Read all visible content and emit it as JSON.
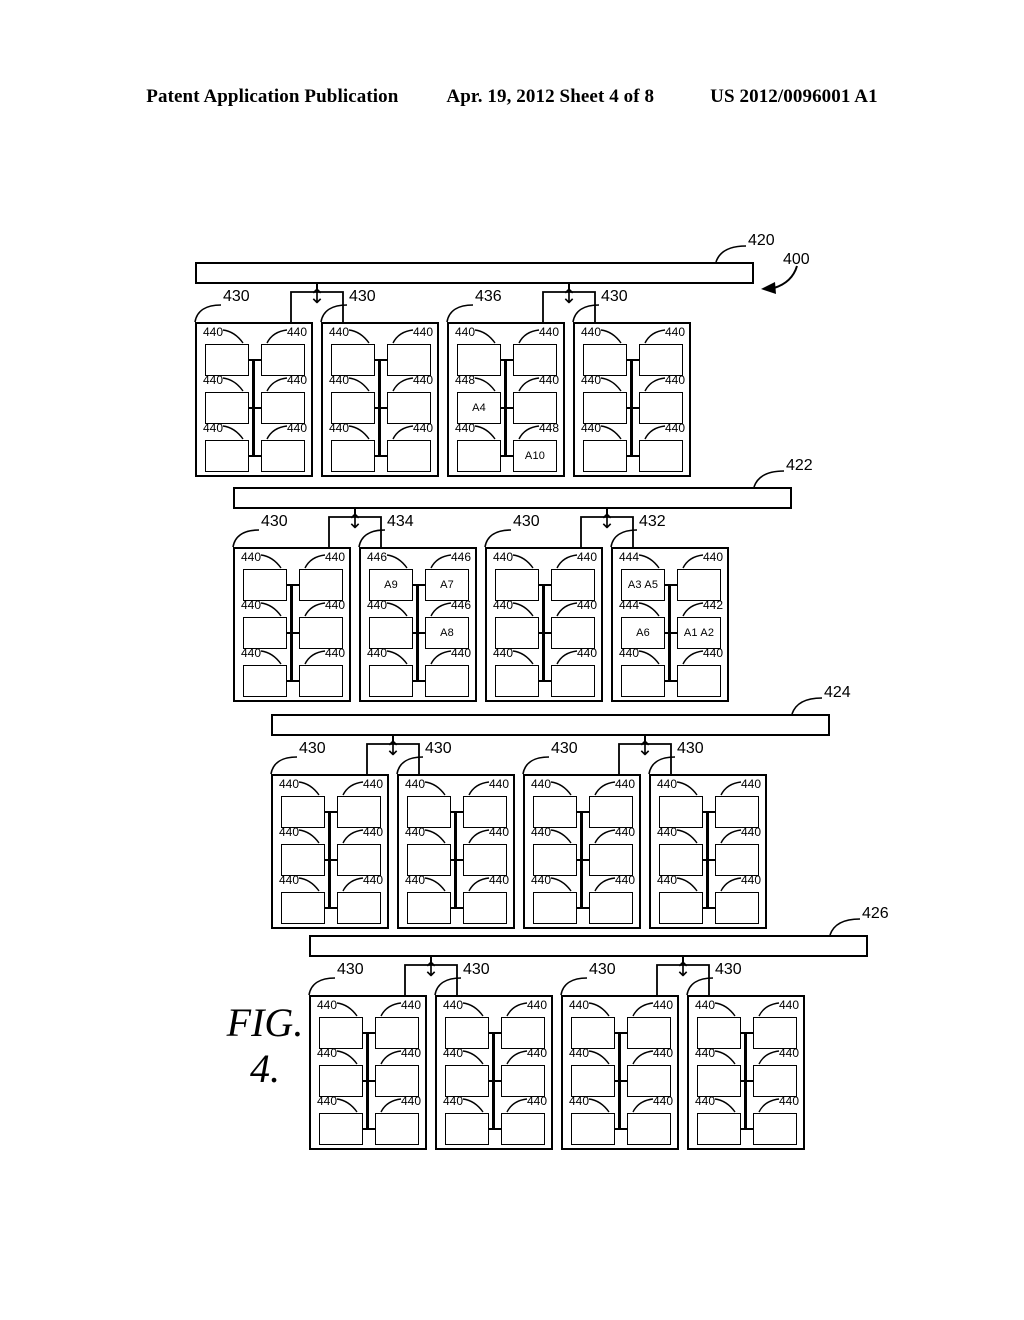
{
  "header": {
    "publication": "Patent Application Publication",
    "date_sheet": "Apr. 19, 2012  Sheet 4 of 8",
    "patent_number": "US 2012/0096001 A1"
  },
  "figure": {
    "caption_line1": "FIG.",
    "caption_line2": "4.",
    "system_ref": "400",
    "cell_default_ref": "440",
    "group_default_ref": "430",
    "arrow_glyph": "↕"
  },
  "banks": [
    {
      "bus_ref": "420",
      "groups": [
        {
          "ref": "430",
          "cells": [
            {
              "ref": "440",
              "text": ""
            },
            {
              "ref": "440",
              "text": ""
            },
            {
              "ref": "440",
              "text": ""
            },
            {
              "ref": "440",
              "text": ""
            },
            {
              "ref": "440",
              "text": ""
            },
            {
              "ref": "440",
              "text": ""
            }
          ]
        },
        {
          "ref": "430",
          "cells": [
            {
              "ref": "440",
              "text": ""
            },
            {
              "ref": "440",
              "text": ""
            },
            {
              "ref": "440",
              "text": ""
            },
            {
              "ref": "440",
              "text": ""
            },
            {
              "ref": "440",
              "text": ""
            },
            {
              "ref": "440",
              "text": ""
            }
          ]
        },
        {
          "ref": "436",
          "cells": [
            {
              "ref": "440",
              "text": ""
            },
            {
              "ref": "440",
              "text": ""
            },
            {
              "ref": "448",
              "text": "A4"
            },
            {
              "ref": "440",
              "text": ""
            },
            {
              "ref": "440",
              "text": ""
            },
            {
              "ref": "448",
              "text": "A10"
            }
          ]
        },
        {
          "ref": "430",
          "cells": [
            {
              "ref": "440",
              "text": ""
            },
            {
              "ref": "440",
              "text": ""
            },
            {
              "ref": "440",
              "text": ""
            },
            {
              "ref": "440",
              "text": ""
            },
            {
              "ref": "440",
              "text": ""
            },
            {
              "ref": "440",
              "text": ""
            }
          ]
        }
      ]
    },
    {
      "bus_ref": "422",
      "groups": [
        {
          "ref": "430",
          "cells": [
            {
              "ref": "440",
              "text": ""
            },
            {
              "ref": "440",
              "text": ""
            },
            {
              "ref": "440",
              "text": ""
            },
            {
              "ref": "440",
              "text": ""
            },
            {
              "ref": "440",
              "text": ""
            },
            {
              "ref": "440",
              "text": ""
            }
          ]
        },
        {
          "ref": "434",
          "cells": [
            {
              "ref": "446",
              "text": "A9"
            },
            {
              "ref": "446",
              "text": "A7"
            },
            {
              "ref": "440",
              "text": ""
            },
            {
              "ref": "446",
              "text": "A8"
            },
            {
              "ref": "440",
              "text": ""
            },
            {
              "ref": "440",
              "text": ""
            }
          ]
        },
        {
          "ref": "430",
          "cells": [
            {
              "ref": "440",
              "text": ""
            },
            {
              "ref": "440",
              "text": ""
            },
            {
              "ref": "440",
              "text": ""
            },
            {
              "ref": "440",
              "text": ""
            },
            {
              "ref": "440",
              "text": ""
            },
            {
              "ref": "440",
              "text": ""
            }
          ]
        },
        {
          "ref": "432",
          "cells": [
            {
              "ref": "444",
              "text": "A3 A5"
            },
            {
              "ref": "440",
              "text": ""
            },
            {
              "ref": "444",
              "text": "A6"
            },
            {
              "ref": "442",
              "text": "A1 A2"
            },
            {
              "ref": "440",
              "text": ""
            },
            {
              "ref": "440",
              "text": ""
            }
          ]
        }
      ]
    },
    {
      "bus_ref": "424",
      "groups": [
        {
          "ref": "430",
          "cells": [
            {
              "ref": "440",
              "text": ""
            },
            {
              "ref": "440",
              "text": ""
            },
            {
              "ref": "440",
              "text": ""
            },
            {
              "ref": "440",
              "text": ""
            },
            {
              "ref": "440",
              "text": ""
            },
            {
              "ref": "440",
              "text": ""
            }
          ]
        },
        {
          "ref": "430",
          "cells": [
            {
              "ref": "440",
              "text": ""
            },
            {
              "ref": "440",
              "text": ""
            },
            {
              "ref": "440",
              "text": ""
            },
            {
              "ref": "440",
              "text": ""
            },
            {
              "ref": "440",
              "text": ""
            },
            {
              "ref": "440",
              "text": ""
            }
          ]
        },
        {
          "ref": "430",
          "cells": [
            {
              "ref": "440",
              "text": ""
            },
            {
              "ref": "440",
              "text": ""
            },
            {
              "ref": "440",
              "text": ""
            },
            {
              "ref": "440",
              "text": ""
            },
            {
              "ref": "440",
              "text": ""
            },
            {
              "ref": "440",
              "text": ""
            }
          ]
        },
        {
          "ref": "430",
          "cells": [
            {
              "ref": "440",
              "text": ""
            },
            {
              "ref": "440",
              "text": ""
            },
            {
              "ref": "440",
              "text": ""
            },
            {
              "ref": "440",
              "text": ""
            },
            {
              "ref": "440",
              "text": ""
            },
            {
              "ref": "440",
              "text": ""
            }
          ]
        }
      ]
    },
    {
      "bus_ref": "426",
      "groups": [
        {
          "ref": "430",
          "cells": [
            {
              "ref": "440",
              "text": ""
            },
            {
              "ref": "440",
              "text": ""
            },
            {
              "ref": "440",
              "text": ""
            },
            {
              "ref": "440",
              "text": ""
            },
            {
              "ref": "440",
              "text": ""
            },
            {
              "ref": "440",
              "text": ""
            }
          ]
        },
        {
          "ref": "430",
          "cells": [
            {
              "ref": "440",
              "text": ""
            },
            {
              "ref": "440",
              "text": ""
            },
            {
              "ref": "440",
              "text": ""
            },
            {
              "ref": "440",
              "text": ""
            },
            {
              "ref": "440",
              "text": ""
            },
            {
              "ref": "440",
              "text": ""
            }
          ]
        },
        {
          "ref": "430",
          "cells": [
            {
              "ref": "440",
              "text": ""
            },
            {
              "ref": "440",
              "text": ""
            },
            {
              "ref": "440",
              "text": ""
            },
            {
              "ref": "440",
              "text": ""
            },
            {
              "ref": "440",
              "text": ""
            },
            {
              "ref": "440",
              "text": ""
            }
          ]
        },
        {
          "ref": "430",
          "cells": [
            {
              "ref": "440",
              "text": ""
            },
            {
              "ref": "440",
              "text": ""
            },
            {
              "ref": "440",
              "text": ""
            },
            {
              "ref": "440",
              "text": ""
            },
            {
              "ref": "440",
              "text": ""
            },
            {
              "ref": "440",
              "text": ""
            }
          ]
        }
      ]
    }
  ]
}
